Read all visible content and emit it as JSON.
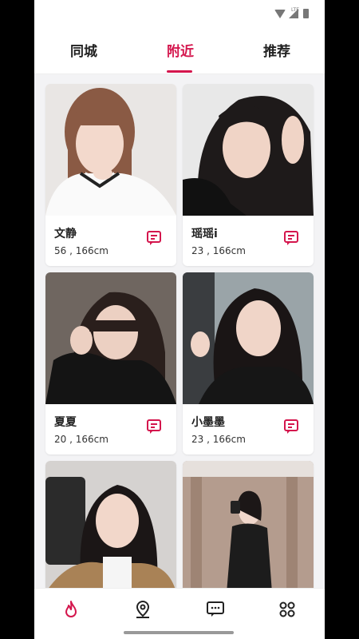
{
  "tabs": [
    {
      "label": "同城",
      "active": false
    },
    {
      "label": "附近",
      "active": true
    },
    {
      "label": "推荐",
      "active": false
    }
  ],
  "status_icons": [
    "wifi-icon",
    "signal-icon",
    "battery-icon"
  ],
  "status_lte": "LTE",
  "accent_color": "#d4164d",
  "cards": [
    {
      "name": "文静",
      "meta": "56 , 166cm"
    },
    {
      "name": "瑶瑶i",
      "meta": "23 , 166cm"
    },
    {
      "name": "夏夏",
      "meta": "20 , 166cm"
    },
    {
      "name": "小墨墨",
      "meta": "23 , 166cm"
    },
    {
      "name": "",
      "meta": ""
    },
    {
      "name": "",
      "meta": ""
    }
  ],
  "bottom_nav": [
    {
      "icon": "flame-icon",
      "active": true
    },
    {
      "icon": "location-pin-icon",
      "active": false
    },
    {
      "icon": "chat-icon",
      "active": false
    },
    {
      "icon": "apps-grid-icon",
      "active": false
    }
  ]
}
